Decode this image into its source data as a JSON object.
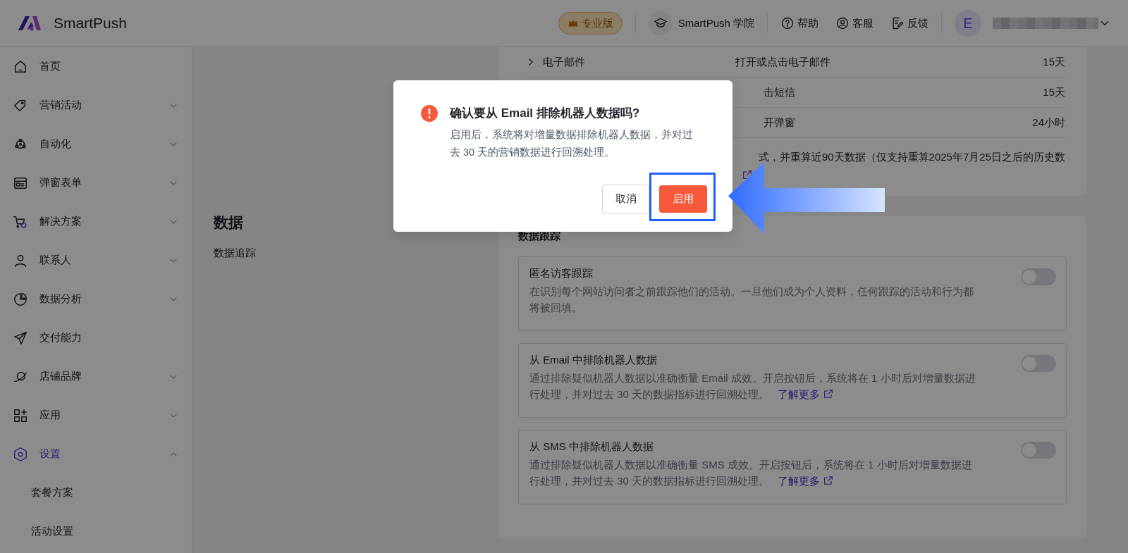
{
  "header": {
    "logo_text": "SmartPush",
    "plan_badge": "专业版",
    "academy": "SmartPush 学院",
    "links": [
      "帮助",
      "客服",
      "反馈"
    ],
    "avatar_letter": "E"
  },
  "sidebar": {
    "items": [
      {
        "label": "首页",
        "selected": false
      },
      {
        "label": "营销活动",
        "selected": false,
        "expanded": false
      },
      {
        "label": "自动化",
        "selected": false,
        "expanded": false
      },
      {
        "label": "弹窗表单",
        "selected": false,
        "expanded": false
      },
      {
        "label": "解决方案",
        "selected": false,
        "expanded": false
      },
      {
        "label": "联系人",
        "selected": false,
        "expanded": false
      },
      {
        "label": "数据分析",
        "selected": false,
        "expanded": false
      },
      {
        "label": "交付能力",
        "selected": false
      },
      {
        "label": "店铺品牌",
        "selected": false,
        "expanded": false
      },
      {
        "label": "应用",
        "selected": false,
        "expanded": false
      },
      {
        "label": "设置",
        "selected": true,
        "expanded": true,
        "children": [
          {
            "label": "套餐方案",
            "selected": false
          },
          {
            "label": "活动设置",
            "selected": false
          }
        ]
      }
    ]
  },
  "section": {
    "title": "数据",
    "subtitle": "数据追踪"
  },
  "expiry_table": {
    "rows": [
      {
        "channel": "电子邮件",
        "event": "打开或点击电子邮件",
        "window": "15天",
        "expanded": false
      },
      {
        "event": "击短信",
        "window": "15天"
      },
      {
        "event": "开弹窗",
        "window": "24小时"
      }
    ],
    "note": "式，并重算近90天数据（仅支持重算2025年7月25日之后的历史数"
  },
  "tracking": {
    "title": "数据跟踪",
    "options": [
      {
        "title": "匿名访客跟踪",
        "description": "在识别每个网站访问者之前跟踪他们的活动。一旦他们成为个人资料，任何跟踪的活动和行为都将被回填。",
        "on": false
      },
      {
        "title": "从 Email 中排除机器人数据",
        "description": "通过排除疑似机器人数据以准确衡量 Email 成效。开启按钮后，系统将在 1 小时后对增量数据进行处理，并对过去 30 天的数据指标进行回溯处理。",
        "link": "了解更多",
        "on": false
      },
      {
        "title": "从 SMS 中排除机器人数据",
        "description": "通过排除疑似机器人数据以准确衡量 SMS 成效。开启按钮后，系统将在 1 小时后对增量数据进行处理，并对过去 30 天的数据指标进行回溯处理。",
        "link": "了解更多",
        "on": false
      }
    ]
  },
  "dialog": {
    "title": "确认要从 Email 排除机器人数据吗?",
    "message": "启用后，系统将对增量数据排除机器人数据，并对过去 30 天的营销数据进行回溯处理。",
    "buttons": [
      {
        "label": "取消",
        "kind": "secondary"
      },
      {
        "label": "启用",
        "kind": "primary",
        "highlighted": true
      }
    ]
  }
}
